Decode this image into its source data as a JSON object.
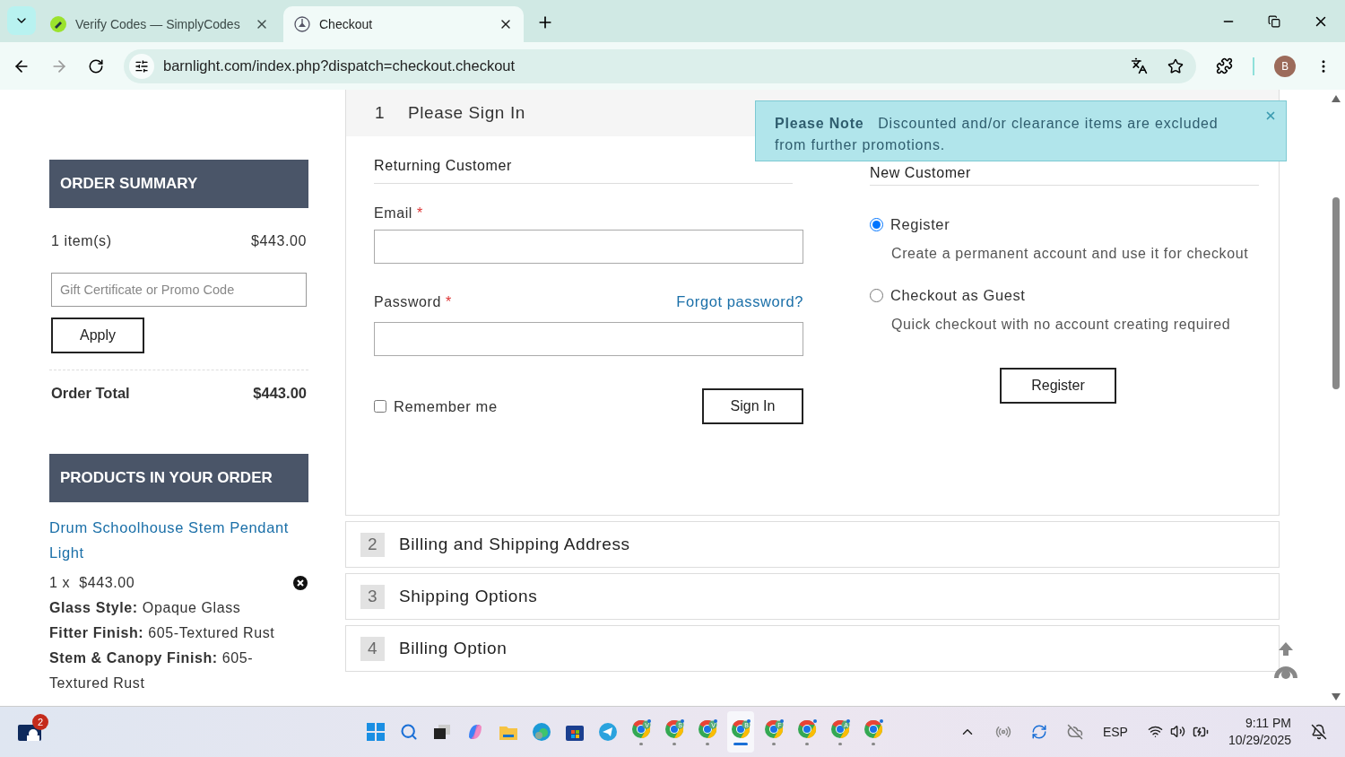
{
  "browser": {
    "tabs": [
      {
        "title": "Verify Codes — SimplyCodes",
        "selected": false
      },
      {
        "title": "Checkout",
        "selected": true
      }
    ],
    "url": "barnlight.com/index.php?dispatch=checkout.checkout",
    "profile": "B"
  },
  "summary": {
    "heading": "ORDER SUMMARY",
    "items_label": "1 item(s)",
    "items_price": "$443.00",
    "promo_placeholder": "Gift Certificate or Promo Code",
    "apply": "Apply",
    "total_label": "Order Total",
    "total_value": "$443.00"
  },
  "products": {
    "heading": "PRODUCTS IN YOUR ORDER",
    "items": [
      {
        "name": "Drum Schoolhouse Stem Pendant Light",
        "quantity": "1 x",
        "price": "$443.00",
        "options": [
          {
            "label": "Glass Style:",
            "value": "Opaque Glass"
          },
          {
            "label": "Fitter Finish:",
            "value": "605-Textured Rust"
          },
          {
            "label": "Stem & Canopy Finish:",
            "value": "605-Textured Rust"
          }
        ]
      }
    ]
  },
  "steps": [
    {
      "number": "1",
      "title": "Please Sign In",
      "expanded": true
    },
    {
      "number": "2",
      "title": "Billing and Shipping Address",
      "expanded": false
    },
    {
      "number": "3",
      "title": "Shipping Options",
      "expanded": false
    },
    {
      "number": "4",
      "title": "Billing Option",
      "expanded": false
    }
  ],
  "returning": {
    "heading": "Returning Customer",
    "email_label": "Email",
    "password_label": "Password",
    "required_mark": "*",
    "forgot": "Forgot password?",
    "remember": "Remember me",
    "remember_checked": false,
    "sign_in": "Sign In"
  },
  "new_customer": {
    "heading": "New Customer",
    "options": [
      {
        "label": "Register",
        "description": "Create a permanent account and use it for checkout",
        "selected": true
      },
      {
        "label": "Checkout as Guest",
        "description": "Quick checkout with no account creating required",
        "selected": false
      }
    ],
    "button": "Register"
  },
  "notice": {
    "title": "Please Note",
    "text": "Discounted and/or clearance items are excluded from further promotions."
  },
  "taskbar": {
    "notification_count": "2",
    "chrome_windows": [
      {
        "avatar": "V",
        "active": false
      },
      {
        "avatar": "S",
        "active": false
      },
      {
        "avatar": "V",
        "active": false
      },
      {
        "avatar": "B",
        "active": true
      },
      {
        "avatar": "F",
        "active": false
      },
      {
        "active": false
      },
      {
        "avatar": "A",
        "active": false
      },
      {
        "active": false
      }
    ],
    "language": "ESP",
    "time": "9:11 PM",
    "date": "10/29/2025"
  }
}
